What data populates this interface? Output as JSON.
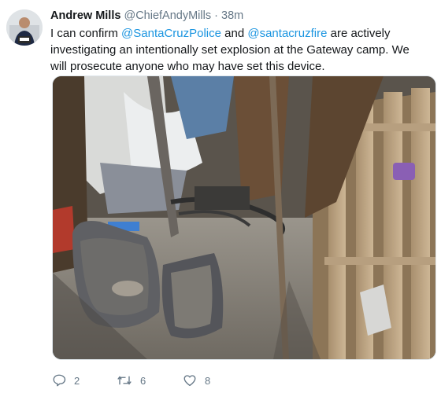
{
  "tweet": {
    "display_name": "Andrew Mills",
    "handle": "@ChiefAndyMills",
    "separator": "·",
    "time": "38m",
    "text": {
      "part1": "I can confirm ",
      "mention1": "@SantaCruzPolice",
      "part2": " and ",
      "mention2": "@santacruzfire",
      "part3": " are actively investigating an intentionally set explosion at the Gateway camp. We will prosecute anyone who may have set this device."
    }
  },
  "actions": {
    "reply_count": "2",
    "retweet_count": "6",
    "like_count": "8"
  },
  "icons": {
    "reply": "reply-icon",
    "retweet": "retweet-icon",
    "like": "like-icon"
  },
  "colors": {
    "mention": "#1b95e0",
    "meta": "#657786",
    "text": "#14171a"
  }
}
